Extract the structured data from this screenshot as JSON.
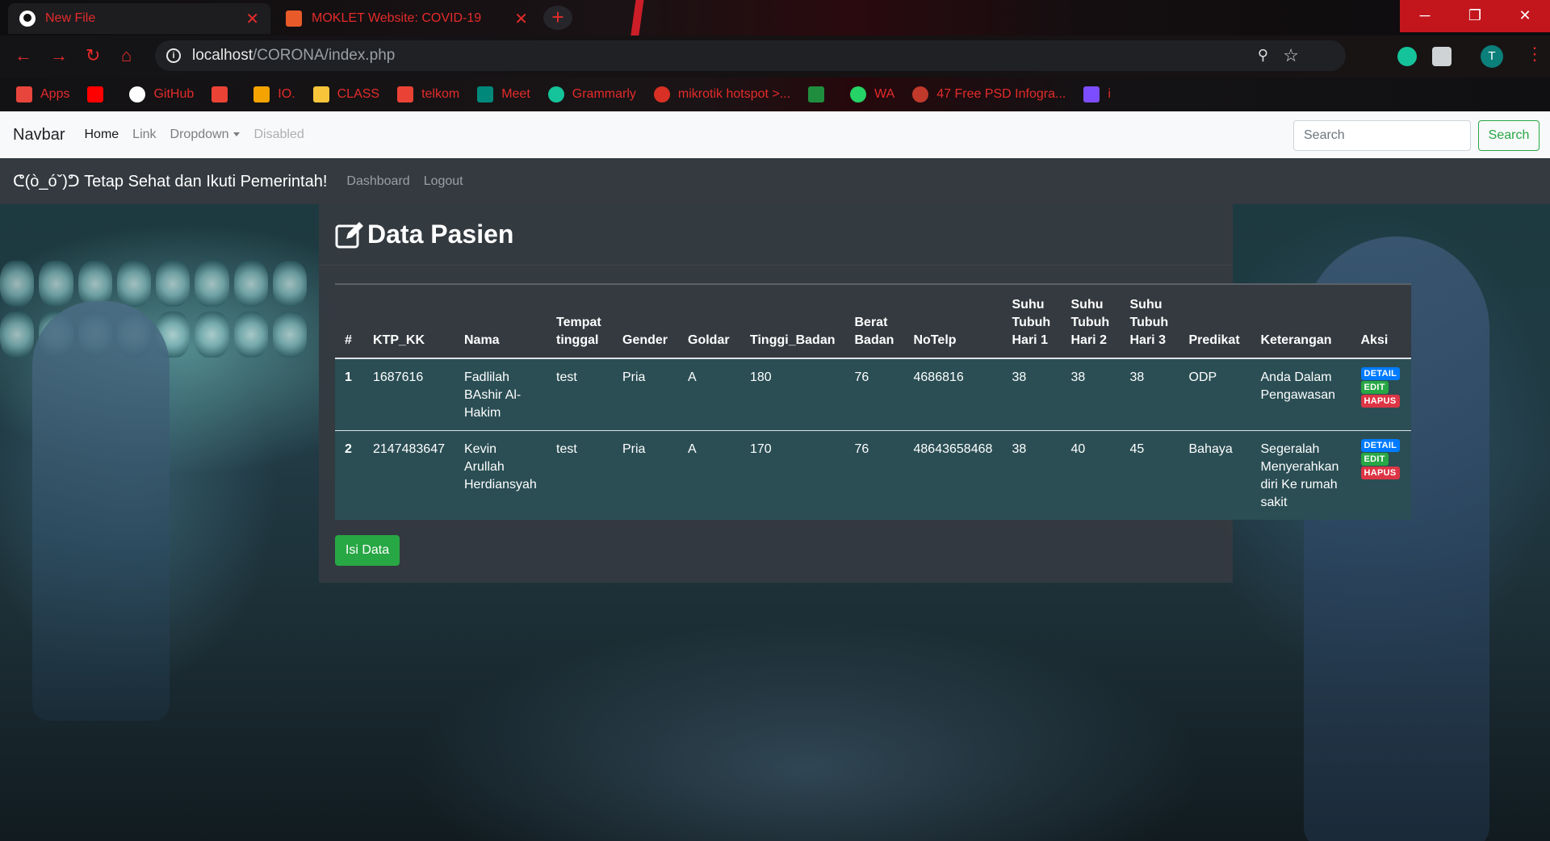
{
  "browser": {
    "tabs": [
      {
        "title": "New File",
        "active": true
      },
      {
        "title": "MOKLET Website: COVID-19",
        "active": false
      }
    ],
    "url_host": "localhost",
    "url_path": "/CORONA/index.php",
    "profile_initial": "T",
    "bookmarks": [
      {
        "label": "Apps",
        "color": "#e8453c"
      },
      {
        "label": "",
        "color": "#ff0000"
      },
      {
        "label": "GitHub",
        "color": "#ffffff"
      },
      {
        "label": "",
        "color": "#ea4335"
      },
      {
        "label": "IO.",
        "color": "#f4a300"
      },
      {
        "label": "CLASS",
        "color": "#f8c53a"
      },
      {
        "label": "telkom",
        "color": "#ea4335"
      },
      {
        "label": "Meet",
        "color": "#00897b"
      },
      {
        "label": "Grammarly",
        "color": "#15c39a"
      },
      {
        "label": "mikrotik hotspot >...",
        "color": "#d93025"
      },
      {
        "label": "",
        "color": "#1e8e3e"
      },
      {
        "label": "WA",
        "color": "#25d366"
      },
      {
        "label": "47 Free PSD Infogra...",
        "color": "#c0392b"
      },
      {
        "label": "i",
        "color": "#7c4dff"
      }
    ]
  },
  "navbar": {
    "brand": "Navbar",
    "links": {
      "home": "Home",
      "link": "Link",
      "dropdown": "Dropdown",
      "disabled": "Disabled"
    },
    "search_placeholder": "Search",
    "search_button": "Search"
  },
  "subbar": {
    "brand": "ᕦ(ò_óˇ)ᕤ Tetap Sehat dan Ikuti Pemerintah!",
    "dashboard": "Dashboard",
    "logout": "Logout"
  },
  "panel": {
    "title": "Data Pasien",
    "button": "Isi Data"
  },
  "table": {
    "headers": [
      "#",
      "KTP_KK",
      "Nama",
      "Tempat tinggal",
      "Gender",
      "Goldar",
      "Tinggi_Badan",
      "Berat Badan",
      "NoTelp",
      "Suhu Tubuh Hari 1",
      "Suhu Tubuh Hari 2",
      "Suhu Tubuh Hari 3",
      "Predikat",
      "Keterangan",
      "Aksi"
    ],
    "rows": [
      [
        "1",
        "1687616",
        "Fadlilah BAshir Al-Hakim",
        "test",
        "Pria",
        "A",
        "180",
        "76",
        "4686816",
        "38",
        "38",
        "38",
        "ODP",
        "Anda Dalam Pengawasan"
      ],
      [
        "2",
        "2147483647",
        "Kevin Arullah Herdiansyah",
        "test",
        "Pria",
        "A",
        "170",
        "76",
        "48643658468",
        "38",
        "40",
        "45",
        "Bahaya",
        "Segeralah Menyerahkan diri Ke rumah sakit"
      ]
    ],
    "actions": {
      "detail": "DETAIL",
      "edit": "EDIT",
      "hapus": "HAPUS"
    }
  }
}
